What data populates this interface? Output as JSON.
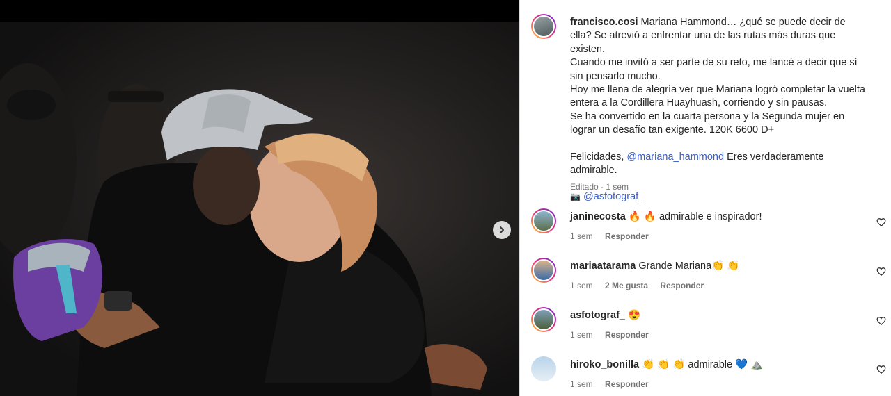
{
  "post": {
    "username": "francisco.cosi",
    "caption_lines": [
      "Mariana Hammond… ¿qué se puede decir de ella? Se atrevió a enfrentar una de las rutas más duras que existen.",
      "Cuando me invitó a ser parte de su reto, me lancé a decir que sí sin pensarlo mucho.",
      "Hoy me llena de alegría ver que Mariana logró completar la vuelta entera a la Cordillera Huayhuash, corriendo y sin pausas.",
      "Se ha convertido en la cuarta persona y la Segunda mujer en lograr un desafío tan exigente. 120K 6600 D+"
    ],
    "congrats_prefix": "Felicidades, ",
    "congrats_mention": "@mariana_hammond",
    "congrats_suffix": " Eres verdaderamente admirable.",
    "camera_emoji": "📷",
    "photo_credit": "@asfotograf_",
    "edited_meta": "Editado · 1 sem"
  },
  "comments": [
    {
      "username": "janinecosta",
      "text": "🔥 🔥 admirable e inspirador!",
      "time": "1 sem",
      "likes": "",
      "reply": "Responder"
    },
    {
      "username": "mariaatarama",
      "text": "Grande Mariana👏 👏",
      "time": "1 sem",
      "likes": "2 Me gusta",
      "reply": "Responder"
    },
    {
      "username": "asfotograf_",
      "text": "😍",
      "time": "1 sem",
      "likes": "",
      "reply": "Responder"
    },
    {
      "username": "hiroko_bonilla",
      "text": "👏 👏 👏 admirable 💙 ⛰️",
      "time": "1 sem",
      "likes": "",
      "reply": "Responder"
    }
  ],
  "icons": {
    "next": "chevron-right-icon",
    "like": "heart-outline-icon"
  },
  "colors": {
    "mention": "#3b5ec9",
    "meta": "#737373",
    "story_ring": "#ee2a7b"
  }
}
